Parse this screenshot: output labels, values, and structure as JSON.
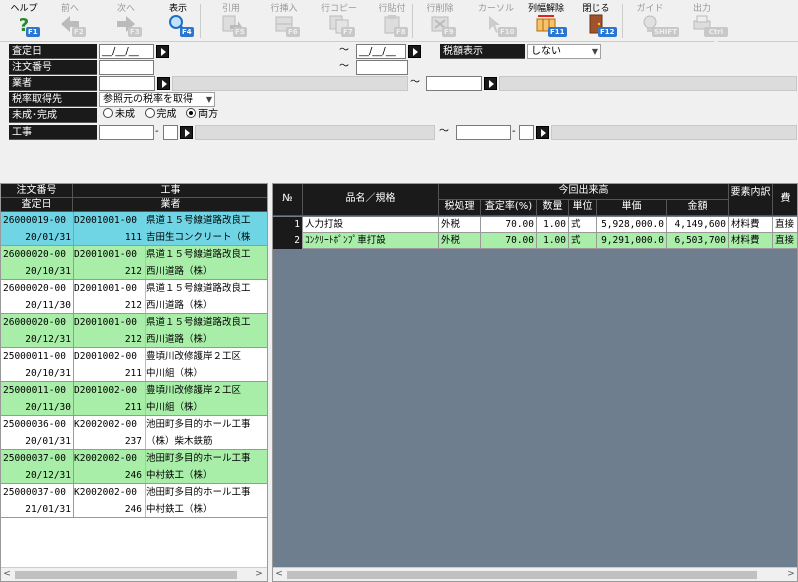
{
  "toolbar": [
    {
      "label": "ヘルプ",
      "key": "F1",
      "icon": "help-icon",
      "enabled": true
    },
    {
      "label": "前へ",
      "key": "F2",
      "icon": "arrow-left-icon",
      "enabled": false
    },
    {
      "label": "次へ",
      "key": "F3",
      "icon": "arrow-right-icon",
      "enabled": false
    },
    {
      "label": "表示",
      "key": "F4",
      "icon": "search-icon",
      "enabled": true
    },
    {
      "label": "引用",
      "key": "F5",
      "icon": "quote-icon",
      "enabled": false
    },
    {
      "label": "行挿入",
      "key": "F6",
      "icon": "insert-row-icon",
      "enabled": false
    },
    {
      "label": "行コピー",
      "key": "F7",
      "icon": "copy-row-icon",
      "enabled": false
    },
    {
      "label": "行貼付",
      "key": "F8",
      "icon": "paste-row-icon",
      "enabled": false
    },
    {
      "label": "行削除",
      "key": "F9",
      "icon": "delete-row-icon",
      "enabled": false
    },
    {
      "label": "カーソル",
      "key": "F10",
      "icon": "cursor-icon",
      "enabled": false
    },
    {
      "label": "列幅解除",
      "key": "F11",
      "icon": "column-width-icon",
      "enabled": true
    },
    {
      "label": "閉じる",
      "key": "F12",
      "icon": "close-door-icon",
      "enabled": true
    },
    {
      "label": "ガイド",
      "key": "SHIFT",
      "icon": "guide-bulb-icon",
      "enabled": false
    },
    {
      "label": "出力",
      "key": "Ctrl P",
      "icon": "print-icon",
      "enabled": false
    }
  ],
  "filters": {
    "assessment_date": {
      "label": "査定日",
      "from": "__/__/__",
      "to": "__/__/__",
      "tilde": "～"
    },
    "order_no": {
      "label": "注文番号",
      "tilde": "～"
    },
    "vendor": {
      "label": "業者",
      "tilde": "～"
    },
    "tax_rate": {
      "label": "税率取得先",
      "value": "参照元の税率を取得"
    },
    "status": {
      "label": "未成･完成",
      "options": [
        "未成",
        "完成",
        "両方"
      ],
      "selected": "両方"
    },
    "construction": {
      "label": "工事",
      "tilde": "～",
      "dash": "-"
    },
    "tax_display": {
      "label": "税額表示",
      "value": "しない"
    }
  },
  "left_table": {
    "headers": {
      "top_left": "注文番号",
      "bottom_left": "査定日",
      "top_right": "工事",
      "bottom_right": "業者"
    },
    "rows": [
      {
        "order": "26000019-00",
        "code": "D2001001-00",
        "project": "県道１５号線道路改良工",
        "date": "20/01/31",
        "vendor_no": "111",
        "vendor": "吉田生コンクリート（株",
        "color": "#6fd4e4"
      },
      {
        "order": "26000020-00",
        "code": "D2001001-00",
        "project": "県道１５号線道路改良工",
        "date": "20/10/31",
        "vendor_no": "212",
        "vendor": "西川道路（株）",
        "color": "#a8eda8"
      },
      {
        "order": "26000020-00",
        "code": "D2001001-00",
        "project": "県道１５号線道路改良工",
        "date": "20/11/30",
        "vendor_no": "212",
        "vendor": "西川道路（株）",
        "color": "#ffffff"
      },
      {
        "order": "26000020-00",
        "code": "D2001001-00",
        "project": "県道１５号線道路改良工",
        "date": "20/12/31",
        "vendor_no": "212",
        "vendor": "西川道路（株）",
        "color": "#a8eda8"
      },
      {
        "order": "25000011-00",
        "code": "D2001002-00",
        "project": "豊頃川改修護岸２工区",
        "date": "20/10/31",
        "vendor_no": "211",
        "vendor": "中川組（株）",
        "color": "#ffffff"
      },
      {
        "order": "25000011-00",
        "code": "D2001002-00",
        "project": "豊頃川改修護岸２工区",
        "date": "20/11/30",
        "vendor_no": "211",
        "vendor": "中川組（株）",
        "color": "#a8eda8"
      },
      {
        "order": "25000036-00",
        "code": "K2002002-00",
        "project": "池田町多目的ホール工事",
        "date": "20/01/31",
        "vendor_no": "237",
        "vendor": "（株）柴木鉄筋",
        "color": "#ffffff"
      },
      {
        "order": "25000037-00",
        "code": "K2002002-00",
        "project": "池田町多目的ホール工事",
        "date": "20/12/31",
        "vendor_no": "246",
        "vendor": "中村鉄工（株）",
        "color": "#a8eda8"
      },
      {
        "order": "25000037-00",
        "code": "K2002002-00",
        "project": "池田町多目的ホール工事",
        "date": "21/01/31",
        "vendor_no": "246",
        "vendor": "中村鉄工（株）",
        "color": "#ffffff"
      }
    ]
  },
  "right_table": {
    "headers": {
      "no": "№",
      "item": "品名／規格",
      "group": "今回出来高",
      "tax": "税処理",
      "rate": "査定率(%)",
      "qty": "数量",
      "unit": "単位",
      "price": "単価",
      "amount": "金額",
      "element": "要素内訳",
      "cost": "費"
    },
    "rows": [
      {
        "no": "1",
        "item": "人力打設",
        "tax": "外税",
        "rate": "70.00",
        "qty": "1.00",
        "unit": "式",
        "price": "5,928,000.0",
        "amount": "4,149,600",
        "element": "材料費",
        "cost": "直接",
        "color": "#ffffff"
      },
      {
        "no": "2",
        "item": "ｺﾝｸﾘｰﾄﾎﾟﾝﾌﾟ車打設",
        "tax": "外税",
        "rate": "70.00",
        "qty": "1.00",
        "unit": "式",
        "price": "9,291,000.0",
        "amount": "6,503,700",
        "element": "材料費",
        "cost": "直接",
        "color": "#a8eda8"
      }
    ]
  },
  "colors": {
    "header_bg": "#1a1a1a",
    "selected_row": "#6fd4e4",
    "alt_row": "#a8eda8",
    "empty_area": "#6e7e8e",
    "fkey": "#2a76d0"
  }
}
